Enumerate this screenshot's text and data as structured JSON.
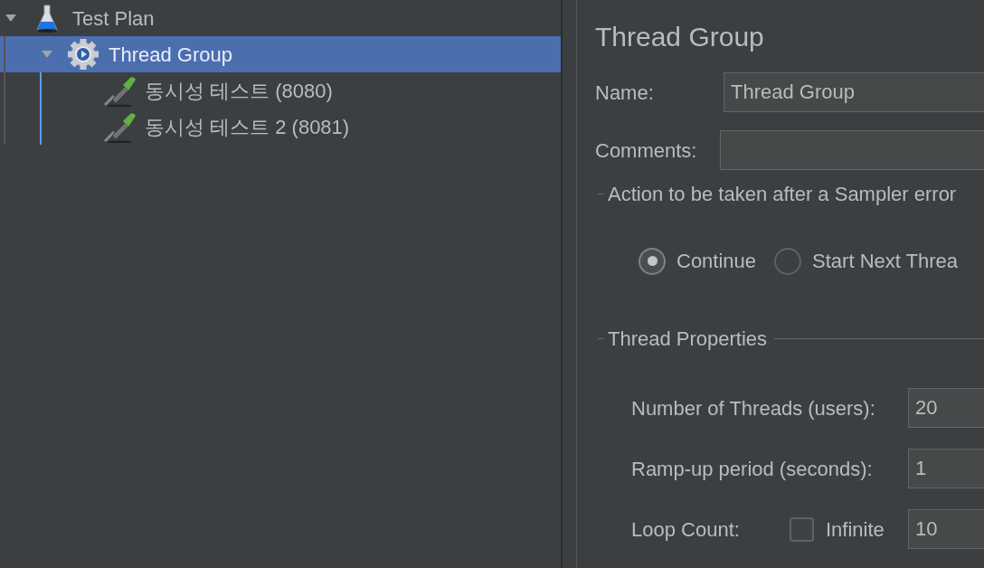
{
  "tree": [
    {
      "kind": "test_plan",
      "label": "Test Plan",
      "expanded": true,
      "selected": false,
      "children": [
        {
          "kind": "thread_group",
          "label": "Thread Group",
          "expanded": true,
          "selected": true,
          "children": [
            {
              "kind": "sampler",
              "label": "동시성 테스트 (8080)",
              "selected": false
            },
            {
              "kind": "sampler",
              "label": "동시성 테스트 2 (8081)",
              "selected": false
            }
          ]
        }
      ]
    }
  ],
  "panel": {
    "title": "Thread Group",
    "name_field": {
      "label": "Name:",
      "value": "Thread Group"
    },
    "comments_field": {
      "label": "Comments:"
    },
    "error_action": {
      "legend": "Action to be taken after a Sampler error",
      "options": [
        {
          "label": "Continue",
          "selected": true
        },
        {
          "label": "Start Next Threa",
          "selected": false
        }
      ]
    },
    "thread_properties": {
      "legend": "Thread Properties",
      "fields": [
        {
          "kind": "text",
          "label": "Number of Threads (users):",
          "value": "20"
        },
        {
          "kind": "text",
          "label": "Ramp-up period (seconds):",
          "value": "1"
        },
        {
          "kind": "loop",
          "label": "Loop Count:",
          "checkbox": {
            "label": "Infinite",
            "checked": false
          },
          "value": "10"
        }
      ]
    }
  }
}
